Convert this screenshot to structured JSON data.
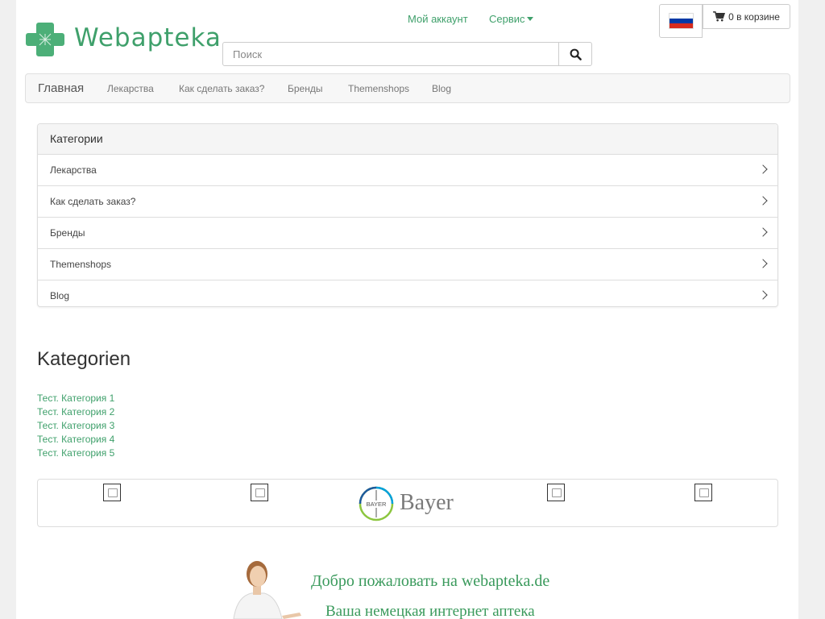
{
  "brand": {
    "logo_text": "Webapteka",
    "accent": "#3fa06b"
  },
  "topbar": {
    "account_label": "Мой аккаунт",
    "service_label": "Сервис",
    "cart_label": "0 в корзине",
    "language_flag": "ru"
  },
  "search": {
    "placeholder": "Поиск"
  },
  "nav": {
    "items": [
      {
        "label": "Главная"
      },
      {
        "label": "Лекарства"
      },
      {
        "label": "Как сделать заказ?"
      },
      {
        "label": "Бренды"
      },
      {
        "label": "Themenshops"
      },
      {
        "label": "Blog"
      }
    ]
  },
  "categories_panel": {
    "title": "Категории",
    "items": [
      {
        "label": "Лекарства"
      },
      {
        "label": "Как сделать заказ?"
      },
      {
        "label": "Бренды"
      },
      {
        "label": "Themenshops"
      },
      {
        "label": "Blog"
      }
    ]
  },
  "kategorien": {
    "title": "Kategorien",
    "links": [
      {
        "label": "Тест. Категория 1"
      },
      {
        "label": "Тест. Категория 2"
      },
      {
        "label": "Тест. Категория 3"
      },
      {
        "label": "Тест. Категория 4"
      },
      {
        "label": "Тест. Категория 5"
      }
    ]
  },
  "brands": {
    "bayer_label": "Bayer",
    "bayer_cross_text": "BAYER"
  },
  "banner": {
    "line1": "Добро пожаловать  на  webapteka.de",
    "line2": "Ваша немецкая интернет аптека"
  }
}
